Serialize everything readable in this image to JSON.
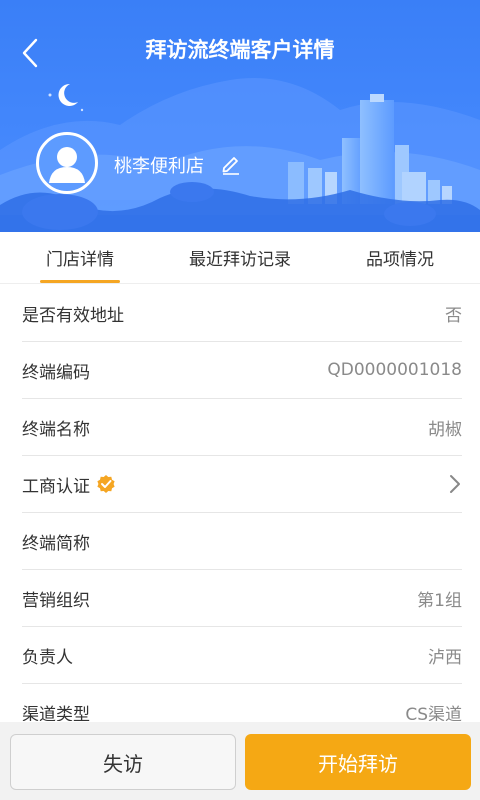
{
  "header": {
    "title": "拜访流终端客户详情",
    "store_name": "桃李便利店",
    "back_icon": "chevron-left-icon",
    "edit_icon": "pencil-icon",
    "avatar_icon": "user-icon",
    "bg_color": "#3f86ff"
  },
  "tabs": [
    {
      "label": "门店详情",
      "active": true
    },
    {
      "label": "最近拜访记录",
      "active": false
    },
    {
      "label": "品项情况",
      "active": false
    }
  ],
  "details": [
    {
      "label": "是否有效地址",
      "value": "否"
    },
    {
      "label": "终端编码",
      "value": "QD0000001018"
    },
    {
      "label": "终端名称",
      "value": "胡椒"
    },
    {
      "label": "工商认证",
      "value": "",
      "badge_icon": "verified-check-icon",
      "chevron_icon": "chevron-right-icon"
    },
    {
      "label": "终端简称",
      "value": ""
    },
    {
      "label": "营销组织",
      "value": "第1组"
    },
    {
      "label": "负责人",
      "value": "泸西"
    },
    {
      "label": "渠道类型",
      "value": "CS渠道"
    }
  ],
  "actions": {
    "absent_label": "失访",
    "start_label": "开始拜访",
    "accent_color": "#f5a814"
  }
}
